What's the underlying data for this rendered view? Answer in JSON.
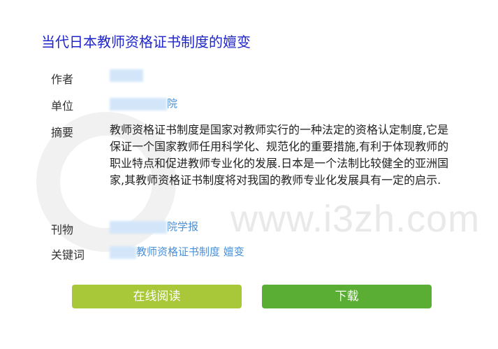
{
  "title": "当代日本教师资格证书制度的嬗变",
  "labels": {
    "author": "作者",
    "unit": "单位",
    "abstract": "摘要",
    "journal": "刊物",
    "keywords": "关键词"
  },
  "unit_visible_suffix": "院",
  "abstract_text": "教师资格证书制度是国家对教师实行的一种法定的资格认定制度,它是保证一个国家教师任用科学化、规范化的重要措施,有利于体现教师的职业特点和促进教师专业化的发展.日本是一个法制比较健全的亚洲国家,其教师资格证书制度将对我国的教师专业化发展具有一定的启示.",
  "journal_visible_suffix": "院学报",
  "keywords_visible": "教师资格证书制度 嬗变",
  "buttons": {
    "read_online": "在线阅读",
    "download": "下载"
  },
  "watermark": "www.i3zh.com",
  "colors": {
    "title": "#1f26c9",
    "link": "#4a90d9",
    "read_button": "#a8c83a",
    "download_button": "#5aae33"
  }
}
